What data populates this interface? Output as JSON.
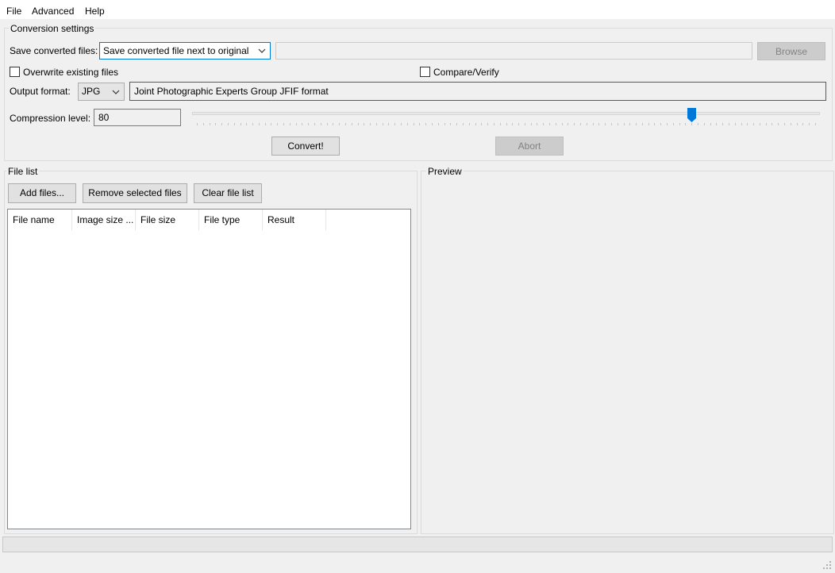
{
  "menu": {
    "items": [
      "File",
      "Advanced",
      "Help"
    ]
  },
  "conversion": {
    "group_title": "Conversion settings",
    "save_label": "Save converted files:",
    "save_option": "Save converted file next to original",
    "path_value": "",
    "browse_label": "Browse",
    "overwrite_label": "Overwrite existing files",
    "overwrite_checked": false,
    "compare_label": "Compare/Verify",
    "compare_checked": false,
    "format_label": "Output format:",
    "format_value": "JPG",
    "format_description": "Joint Photographic Experts Group JFIF format",
    "compression_label": "Compression level:",
    "compression_value": "80",
    "slider_value": 80,
    "slider_max": 100,
    "convert_label": "Convert!",
    "abort_label": "Abort"
  },
  "file_list": {
    "group_title": "File list",
    "add_label": "Add files...",
    "remove_label": "Remove selected files",
    "clear_label": "Clear file list",
    "columns": [
      "File name",
      "Image size ...",
      "File size",
      "File type",
      "Result"
    ],
    "rows": []
  },
  "preview": {
    "group_title": "Preview"
  },
  "colors": {
    "accent": "#0078d7",
    "window_bg": "#f0f0f0"
  }
}
